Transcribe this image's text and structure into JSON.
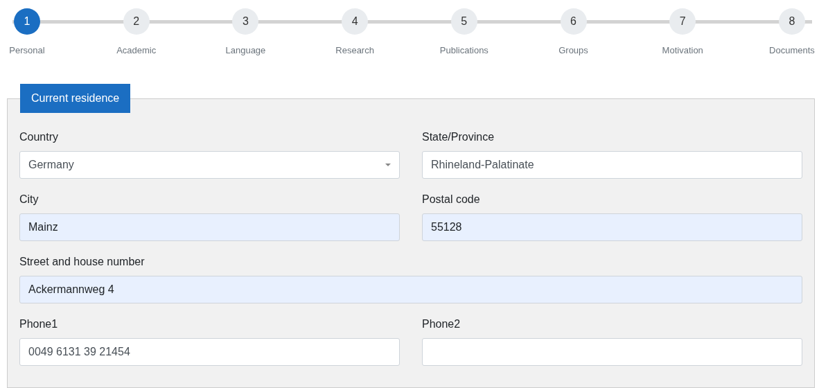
{
  "steps": [
    {
      "number": "1",
      "label": "Personal",
      "selected": true
    },
    {
      "number": "2",
      "label": "Academic",
      "selected": false
    },
    {
      "number": "3",
      "label": "Language",
      "selected": false
    },
    {
      "number": "4",
      "label": "Research",
      "selected": false
    },
    {
      "number": "5",
      "label": "Publications",
      "selected": false
    },
    {
      "number": "6",
      "label": "Groups",
      "selected": false
    },
    {
      "number": "7",
      "label": "Motivation",
      "selected": false
    },
    {
      "number": "8",
      "label": "Documents",
      "selected": false
    }
  ],
  "section": {
    "legend": "Current residence",
    "fields": [
      {
        "label": "Country",
        "kind": "select",
        "value": "Germany",
        "autofilled": false,
        "wide": false
      },
      {
        "label": "State/Province",
        "kind": "text",
        "value": "Rhineland-Palatinate",
        "autofilled": false,
        "wide": false
      },
      {
        "label": "City",
        "kind": "text",
        "value": "Mainz",
        "autofilled": true,
        "wide": false
      },
      {
        "label": "Postal code",
        "kind": "text",
        "value": "55128",
        "autofilled": true,
        "wide": false
      },
      {
        "label": "Street and house number",
        "kind": "text",
        "value": "Ackermannweg 4",
        "autofilled": true,
        "wide": true
      },
      {
        "label": "Phone1",
        "kind": "text",
        "value": "0049 6131 39 21454",
        "autofilled": false,
        "wide": false
      },
      {
        "label": "Phone2",
        "kind": "text",
        "autofilled": false,
        "wide": false
      }
    ]
  }
}
